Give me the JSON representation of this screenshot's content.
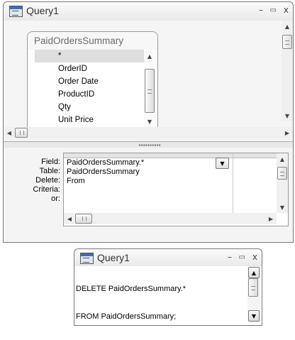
{
  "query_window": {
    "title": "Query1",
    "controls": {
      "minimize": "–",
      "maximize": "▭",
      "close": "x"
    },
    "table": {
      "name": "PaidOrdersSummary",
      "fields": [
        "*",
        "OrderID",
        "Order Date",
        "ProductID",
        "Qty",
        "Unit Price"
      ],
      "selected_field": "*"
    },
    "grid": {
      "row_labels": {
        "field": "Field:",
        "table": "Table:",
        "delete": "Delete:",
        "criteria": "Criteria:",
        "or": "or:"
      },
      "column1": {
        "field": "PaidOrdersSummary.*",
        "table": "PaidOrdersSummary",
        "delete": "From",
        "criteria": "",
        "or": ""
      }
    }
  },
  "sql_window": {
    "title": "Query1",
    "controls": {
      "minimize": "–",
      "maximize": "▭",
      "close": "x"
    },
    "sql_line1": "DELETE PaidOrdersSummary.*",
    "sql_line2": "FROM PaidOrdersSummary;"
  },
  "icons": [
    "query-window-icon",
    "scroll-up-icon",
    "scroll-down-icon",
    "scroll-left-icon",
    "scroll-right-icon",
    "dropdown-arrow-icon"
  ]
}
